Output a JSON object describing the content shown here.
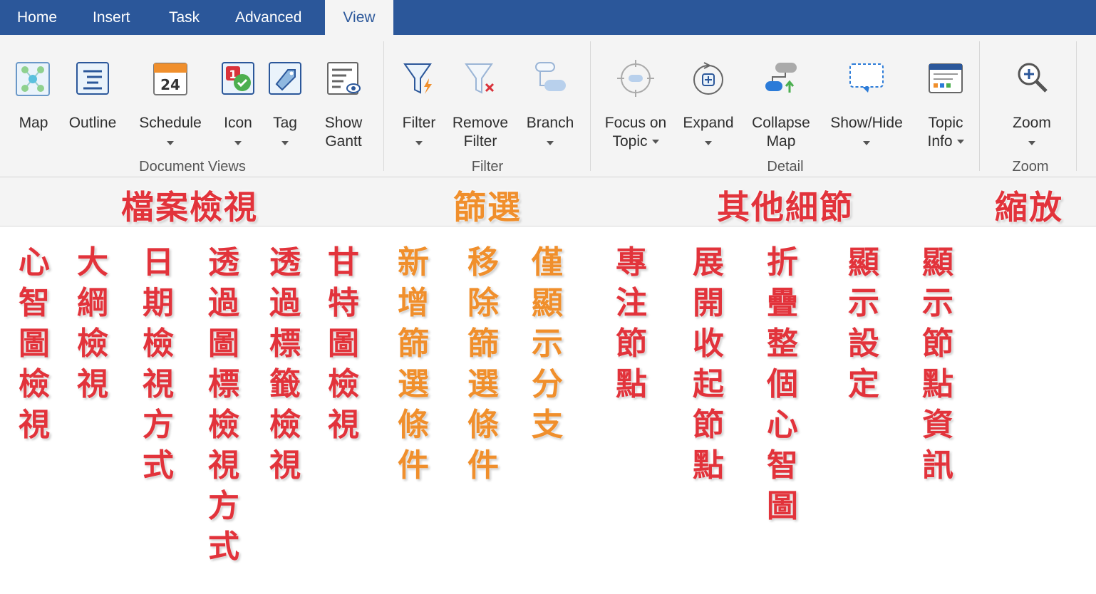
{
  "tabs": [
    "Home",
    "Insert",
    "Task",
    "Advanced",
    "View"
  ],
  "active_tab": "View",
  "colors": {
    "tabbar": "#2b579a",
    "annotation_red": "#e2333b",
    "annotation_orange": "#f08f2c"
  },
  "ribbon": {
    "buttons": [
      {
        "key": "map",
        "label1": "Map",
        "label2": "",
        "icon": "map-icon"
      },
      {
        "key": "outline",
        "label1": "Outline",
        "label2": "",
        "icon": "outline-icon"
      },
      {
        "key": "schedule",
        "label1": "Schedule",
        "label2": "",
        "icon": "calendar-24-icon"
      },
      {
        "key": "icon",
        "label1": "Icon",
        "label2": "",
        "icon": "icon-badge-icon"
      },
      {
        "key": "tag",
        "label1": "Tag",
        "label2": "",
        "icon": "tag-icon"
      },
      {
        "key": "gantt",
        "label1": "Show",
        "label2": "Gantt",
        "icon": "gantt-icon"
      },
      {
        "key": "filter",
        "label1": "Filter",
        "label2": "",
        "icon": "filter-icon"
      },
      {
        "key": "remove_filter",
        "label1": "Remove",
        "label2": "Filter",
        "icon": "remove-filter-icon"
      },
      {
        "key": "branch",
        "label1": "Branch",
        "label2": "",
        "icon": "branch-icon"
      },
      {
        "key": "focus",
        "label1": "Focus on",
        "label2": "Topic",
        "icon": "focus-target-icon"
      },
      {
        "key": "expand",
        "label1": "Expand",
        "label2": "",
        "icon": "expand-icon"
      },
      {
        "key": "collapse",
        "label1": "Collapse",
        "label2": "Map",
        "icon": "collapse-map-icon"
      },
      {
        "key": "showhide",
        "label1": "Show/Hide",
        "label2": "",
        "icon": "show-hide-icon"
      },
      {
        "key": "topicinfo",
        "label1": "Topic",
        "label2": "Info",
        "icon": "topic-info-icon"
      },
      {
        "key": "zoom",
        "label1": "Zoom",
        "label2": "",
        "icon": "zoom-icon"
      }
    ],
    "groups": [
      "Document Views",
      "Filter",
      "Detail",
      "Zoom"
    ]
  },
  "annotations": {
    "group_titles": [
      "檔案檢視",
      "篩選",
      "其他細節",
      "縮放"
    ],
    "columns": [
      "心智圖檢視",
      "大綱檢視",
      "日期檢視方式",
      "透過圖標檢視方式",
      "透過標籤檢視",
      "甘特圖檢視",
      "新增篩選條件",
      "移除篩選條件",
      "僅顯示分支",
      "專注節點",
      "展開收起節點",
      "折疊整個心智圖",
      "顯示設定",
      "顯示節點資訊"
    ]
  }
}
